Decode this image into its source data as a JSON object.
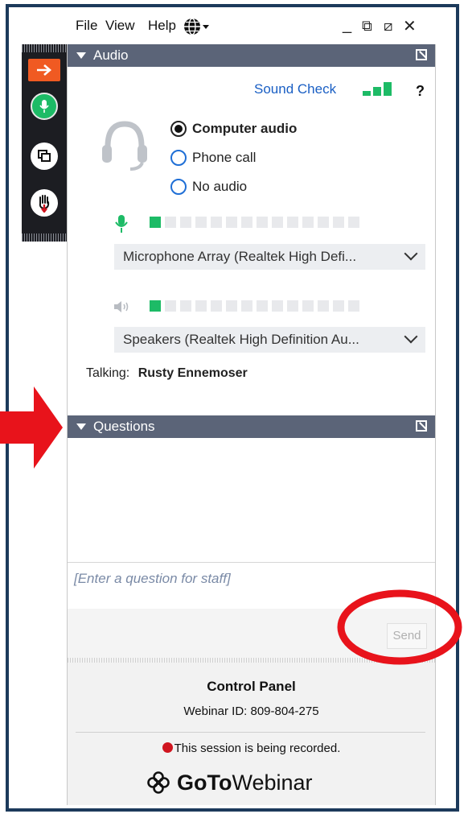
{
  "menu": {
    "file": "File",
    "view": "View",
    "help": "Help"
  },
  "window_controls": {
    "minimize": "_",
    "restore": "⧉",
    "popout": "⧄",
    "close": "✕"
  },
  "dock": {
    "items": [
      "collapse-arrow",
      "microphone",
      "screen-share",
      "raise-hand"
    ]
  },
  "audio": {
    "title": "Audio",
    "sound_check": "Sound Check",
    "help": "?",
    "options": [
      {
        "label": "Computer audio",
        "selected": true
      },
      {
        "label": "Phone call",
        "selected": false
      },
      {
        "label": "No audio",
        "selected": false
      }
    ],
    "mic_level": 1,
    "mic_level_segments": 14,
    "microphone_device": "Microphone Array (Realtek High Defi...",
    "speaker_level": 1,
    "speaker_level_segments": 14,
    "speaker_device": "Speakers (Realtek High Definition Au...",
    "talking_label": "Talking:",
    "talking_name": "Rusty Ennemoser"
  },
  "questions": {
    "title": "Questions",
    "placeholder": "[Enter a question for staff]",
    "send": "Send"
  },
  "footer": {
    "title": "Control Panel",
    "webinar_id": "Webinar ID: 809-804-275",
    "recording": "This session is being recorded.",
    "brand_bold": "GoTo",
    "brand_rest": "Webinar"
  },
  "colors": {
    "header_bar": "#5b6478",
    "accent_blue": "#1a5fc4",
    "meter_green": "#1dbb66",
    "annotation_red": "#e8131b",
    "dock_orange": "#f05a22"
  }
}
